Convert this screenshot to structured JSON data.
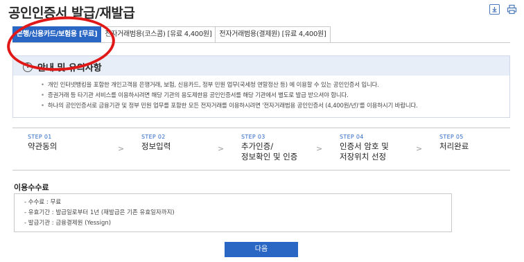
{
  "page": {
    "title": "공인인증서 발급/재발급"
  },
  "top_icons": [
    {
      "name": "download-icon",
      "glyph": "⤓"
    },
    {
      "name": "print-icon",
      "glyph": "⎙"
    }
  ],
  "tabs": [
    {
      "label": "은행/신용카드/보험용 [무료]",
      "active": true
    },
    {
      "label": "전자거래범용(코스콤) [유료 4,400원]",
      "active": false
    },
    {
      "label": "전자거래범용(결제원) [유료 4,400원]",
      "active": false
    }
  ],
  "notice": {
    "title": "안내 및 유의사항",
    "items": [
      "개인 인터넷뱅킹을 포함한 개인고객용 은행거래, 보험, 신용카드, 정부 민원 업무(국세청 연말정산 등) 에 이용할 수 있는 공인인증서 입니다.",
      "증권거래 등 타기관 서비스를 이용하시려면 해당 기관의 용도제한용 공인인증서를 해당 기관에서 별도로 발급 받으셔야 합니다.",
      "하나의 공인인증서로 금융기관 및 정부 민원 업무를 포함한 모든 전자거래를 이용하시려면 '전자거래범용 공인인증서 (4,400원/년)'를 이용하시기 바랍니다."
    ]
  },
  "steps": [
    {
      "no": "STEP 01",
      "name": [
        "약관동의"
      ]
    },
    {
      "no": "STEP 02",
      "name": [
        "정보입력"
      ]
    },
    {
      "no": "STEP 03",
      "name": [
        "추가인증/",
        "정보확인 및 인증"
      ]
    },
    {
      "no": "STEP 04",
      "name": [
        "인증서 암호 및",
        "저장위치 선정"
      ]
    },
    {
      "no": "STEP 05",
      "name": [
        "처리완료"
      ]
    }
  ],
  "step_arrow": ">",
  "fee": {
    "title": "이용수수료",
    "items": [
      "- 수수료 : 무료",
      "- 유효기간 : 발급일로부터 1년 (재발급은 기존 유효일자까지)",
      "- 발급기관 : 금융결제원 (Yessign)"
    ]
  },
  "next_button": "다음",
  "colors": {
    "accent": "#2a66c4",
    "highlight": "#e01818"
  }
}
